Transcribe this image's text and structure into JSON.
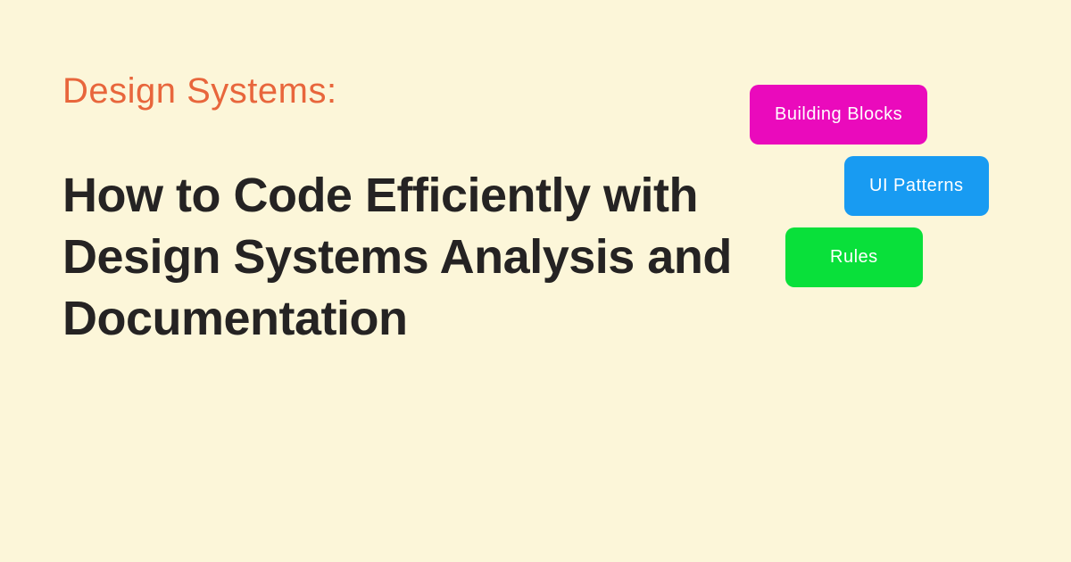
{
  "eyebrow": "Design Systems:",
  "headline": "How to Code Efficiently with Design Systems Analysis and Documentation",
  "cards": {
    "magenta": "Building Blocks",
    "blue": "UI Patterns",
    "green": "Rules"
  }
}
